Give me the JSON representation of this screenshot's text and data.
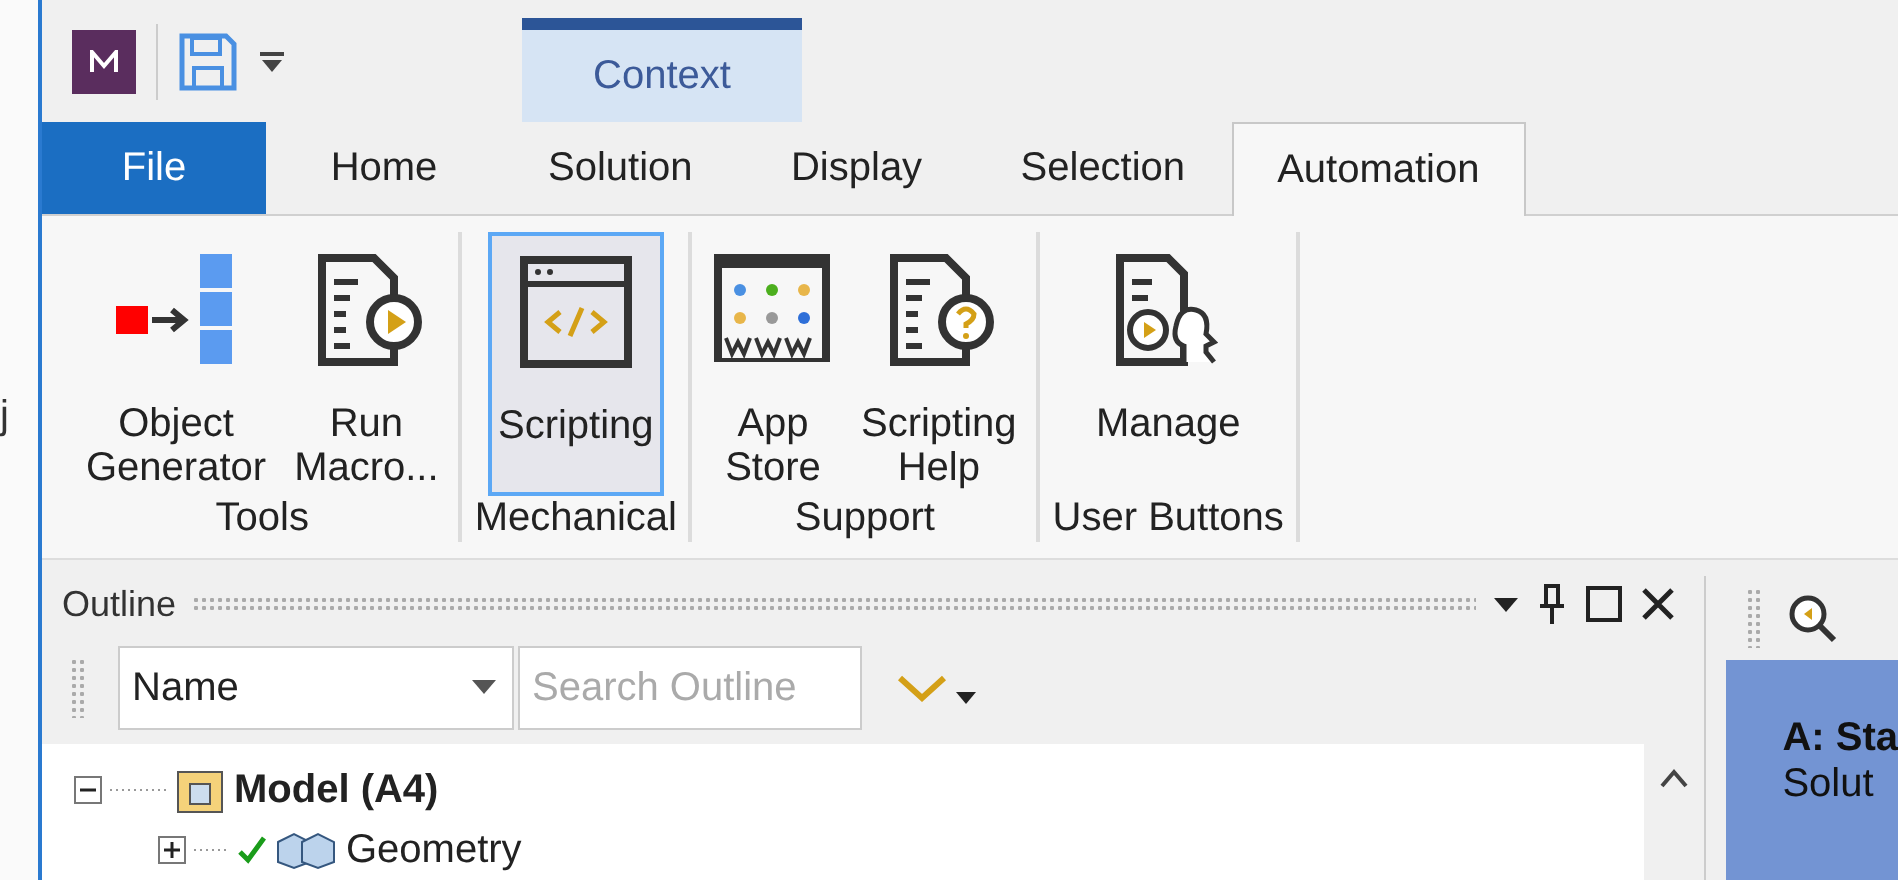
{
  "background_window": {
    "text": "j"
  },
  "context_tab": {
    "label": "Context"
  },
  "tabs": [
    {
      "label": "File",
      "kind": "file",
      "selected": false
    },
    {
      "label": "Home",
      "kind": "tab",
      "selected": false
    },
    {
      "label": "Solution",
      "kind": "tab",
      "selected": false
    },
    {
      "label": "Display",
      "kind": "tab",
      "selected": false
    },
    {
      "label": "Selection",
      "kind": "tab",
      "selected": false
    },
    {
      "label": "Automation",
      "kind": "tab",
      "selected": true
    }
  ],
  "ribbon_groups": [
    {
      "label": "Tools",
      "buttons": [
        {
          "lines": [
            "Object",
            "Generator"
          ],
          "kind": "object-generator",
          "selected": false
        },
        {
          "lines": [
            "Run",
            "Macro..."
          ],
          "kind": "run-macro",
          "selected": false
        }
      ]
    },
    {
      "label": "Mechanical",
      "buttons": [
        {
          "lines": [
            "Scripting"
          ],
          "kind": "scripting",
          "selected": true
        }
      ]
    },
    {
      "label": "Support",
      "buttons": [
        {
          "lines": [
            "App",
            "Store"
          ],
          "kind": "app-store",
          "selected": false
        },
        {
          "lines": [
            "Scripting",
            "Help"
          ],
          "kind": "scripting-help",
          "selected": false
        }
      ]
    },
    {
      "label": "User Buttons",
      "buttons": [
        {
          "lines": [
            "Manage"
          ],
          "kind": "manage",
          "selected": false
        }
      ]
    }
  ],
  "outline": {
    "title": "Outline",
    "filter": {
      "value": "Name"
    },
    "search": {
      "placeholder": "Search Outline"
    },
    "tree": [
      {
        "label": "Model (A4)",
        "expanded": true,
        "checked": false,
        "children": [
          {
            "label": "Geometry",
            "expanded": false,
            "checked": true
          }
        ]
      }
    ]
  },
  "details_panel": {
    "title": "A: Sta",
    "lines": [
      "Solut"
    ]
  }
}
